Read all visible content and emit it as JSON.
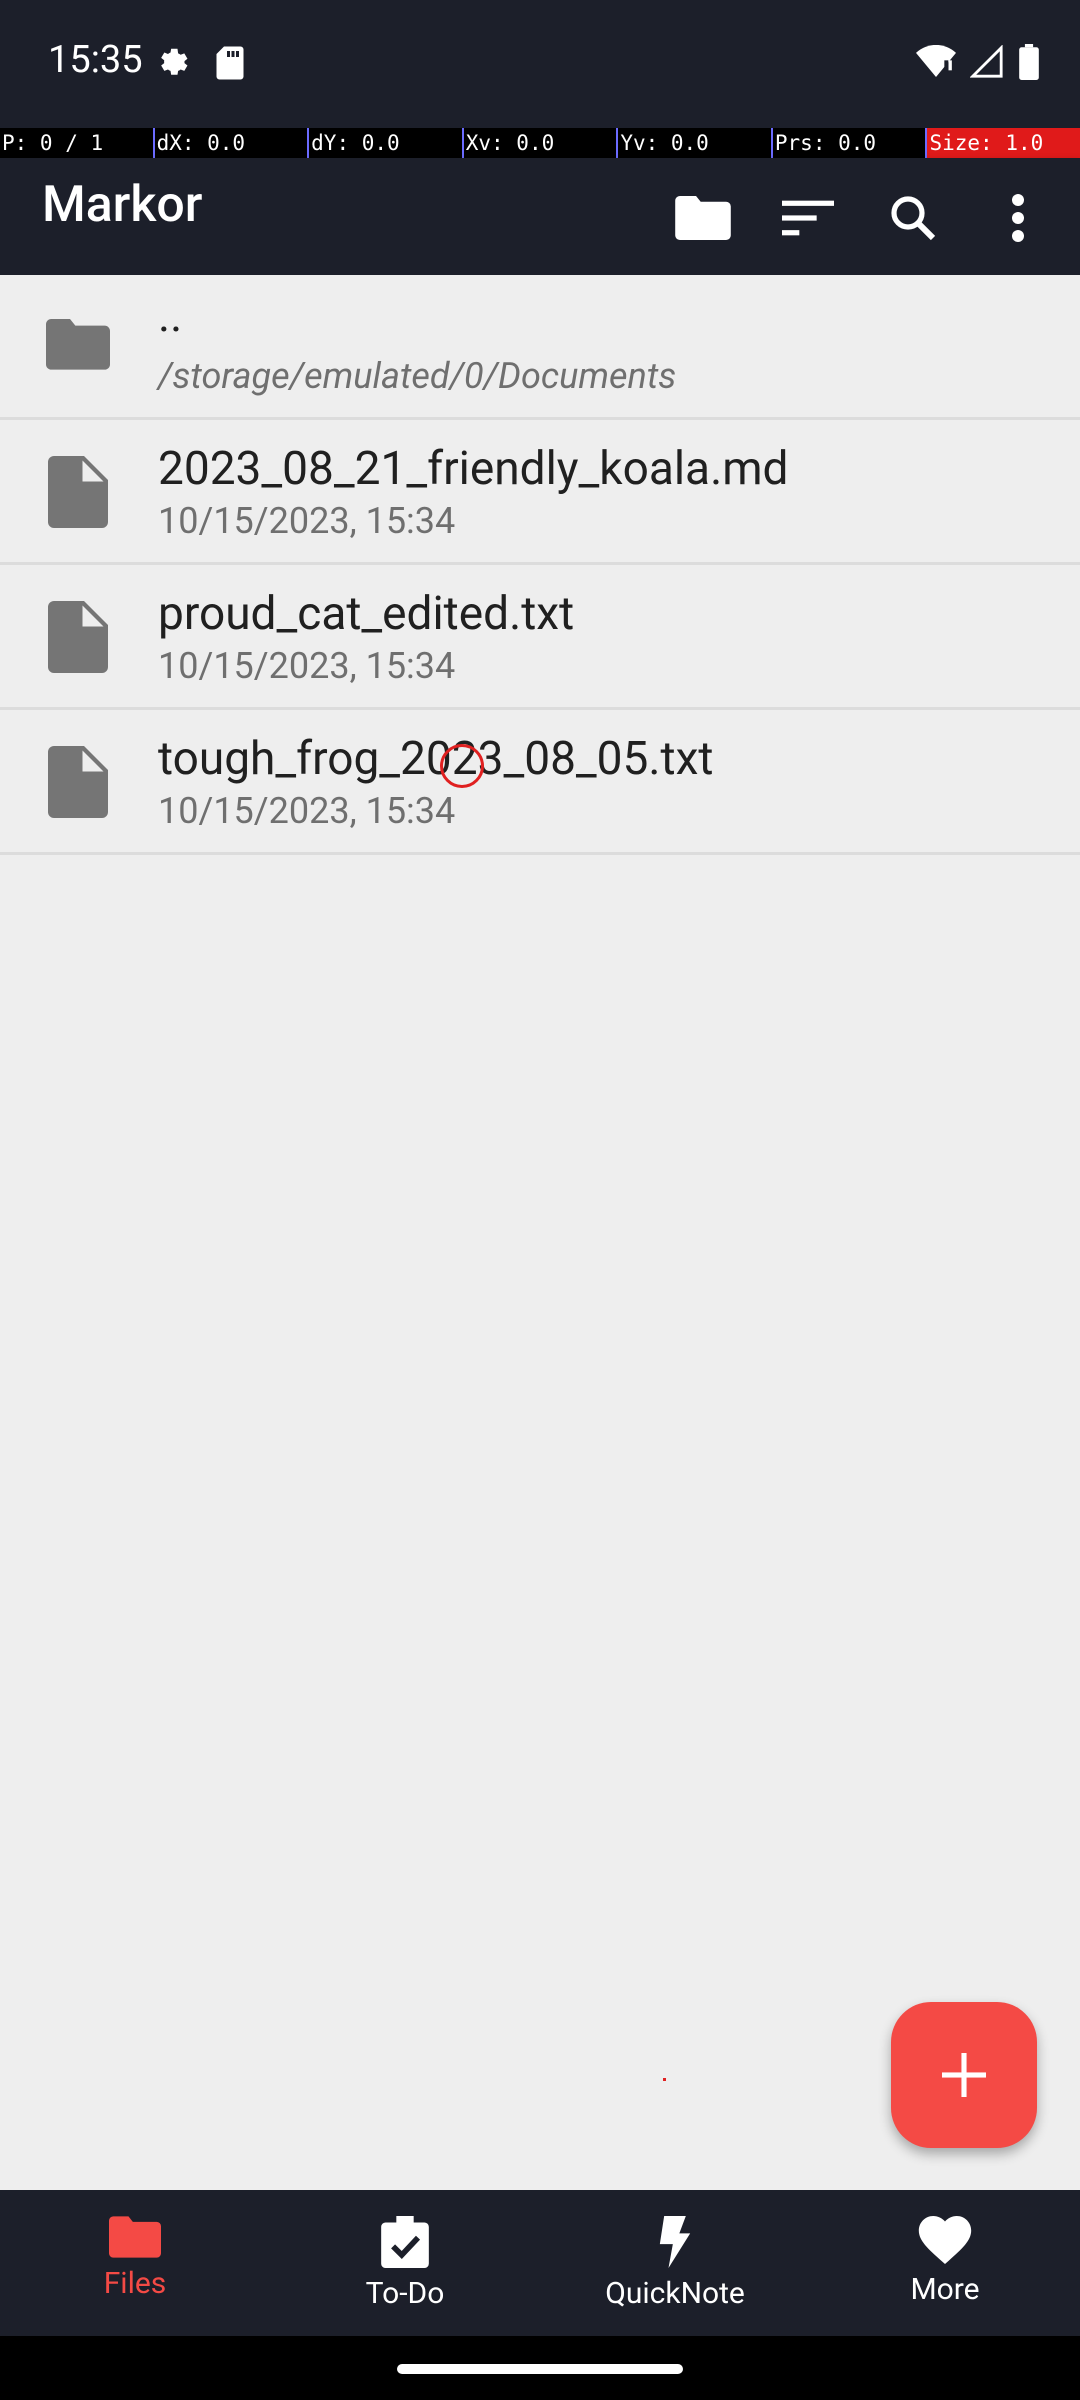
{
  "status_bar": {
    "time": "15:35",
    "icons": [
      "settings-icon",
      "sd-card-icon",
      "wifi-icon",
      "signal-icon",
      "battery-icon"
    ]
  },
  "pointer_info": {
    "p": "P: 0 / 1",
    "dx": "dX: 0.0",
    "dy": "dY: 0.0",
    "xv": "Xv: 0.0",
    "yv": "Yv: 0.0",
    "prs": "Prs: 0.0",
    "size": "Size: 1.0"
  },
  "app_bar": {
    "title": "Markor",
    "actions": [
      "folder-icon",
      "sort-icon",
      "search-icon",
      "more-vert-icon"
    ]
  },
  "files": [
    {
      "type": "folder",
      "name": "..",
      "sub": "/storage/emulated/0/Documents"
    },
    {
      "type": "file",
      "name": "2023_08_21_friendly_koala.md",
      "sub": "10/15/2023, 15:34"
    },
    {
      "type": "file",
      "name": "proud_cat_edited.txt",
      "sub": "10/15/2023, 15:34"
    },
    {
      "type": "file",
      "name": "tough_frog_2023_08_05.txt",
      "sub": "10/15/2023, 15:34"
    }
  ],
  "fab": {
    "icon": "plus-icon"
  },
  "bottom_nav": [
    {
      "label": "Files",
      "icon": "folder-icon",
      "active": true
    },
    {
      "label": "To-Do",
      "icon": "checklist-icon",
      "active": false
    },
    {
      "label": "QuickNote",
      "icon": "lightning-icon",
      "active": false
    },
    {
      "label": "More",
      "icon": "heart-icon",
      "active": false
    }
  ],
  "colors": {
    "accent": "#f44a45",
    "bar": "#1c1f2a",
    "background": "#eeeeee"
  }
}
